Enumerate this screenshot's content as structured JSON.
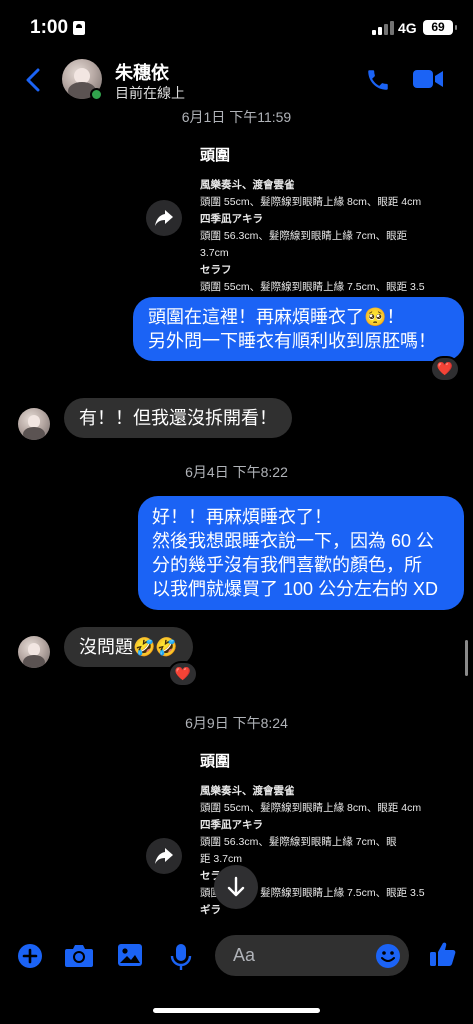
{
  "status_bar": {
    "time": "1:00",
    "network": "4G",
    "battery": "69"
  },
  "header": {
    "contact_name": "朱穗依",
    "status": "目前在線上",
    "accent": "#1b63f5"
  },
  "timestamps": {
    "t1": "6月1日 下午11:59",
    "t2": "6月4日 下午8:22",
    "t3": "6月9日 下午8:24"
  },
  "shared_post_1": {
    "title": "頭圍",
    "lines": [
      "風樂奏斗、渡會雲雀",
      "頭圍 55cm、髮際線到眼睛上緣 8cm、眼距 4cm",
      "四季凪アキラ",
      "頭圍 56.3cm、髮際線到眼睛上緣 7cm、眼距",
      "3.7cm",
      "セラフ",
      "頭圍 55cm、髮際線到眼睛上緣 7.5cm、眼距 3.5"
    ]
  },
  "messages": {
    "m1": [
      "頭圍在這裡！再麻煩睡衣了🥺！",
      "另外問一下睡衣有順利收到原胚嗎！"
    ],
    "m2": "有！！但我還沒拆開看！",
    "m3": [
      "好！！再麻煩睡衣了！",
      "然後我想跟睡衣說一下，因為 60 公",
      "分的幾乎沒有我們喜歡的顏色，所",
      "以我們就爆買了 100 公分左右的 XD"
    ],
    "m4": "沒問題🤣🤣"
  },
  "reactions": {
    "r1": "❤️",
    "r2": "❤️"
  },
  "shared_post_2": {
    "title": "頭圍",
    "lines": [
      "風樂奏斗、渡會雲雀",
      "頭圍 55cm、髮際線到眼睛上緣 8cm、眼距 4cm",
      "四季凪アキラ",
      "頭圍 56.3cm、髮際線到眼睛上緣 7cm、眼",
      "距 3.7cm",
      "セラ",
      "頭圍 55cm、髮際線到眼睛上緣 7.5cm、眼距 3.5",
      "ギラ"
    ]
  },
  "composer": {
    "placeholder": "Aa"
  }
}
